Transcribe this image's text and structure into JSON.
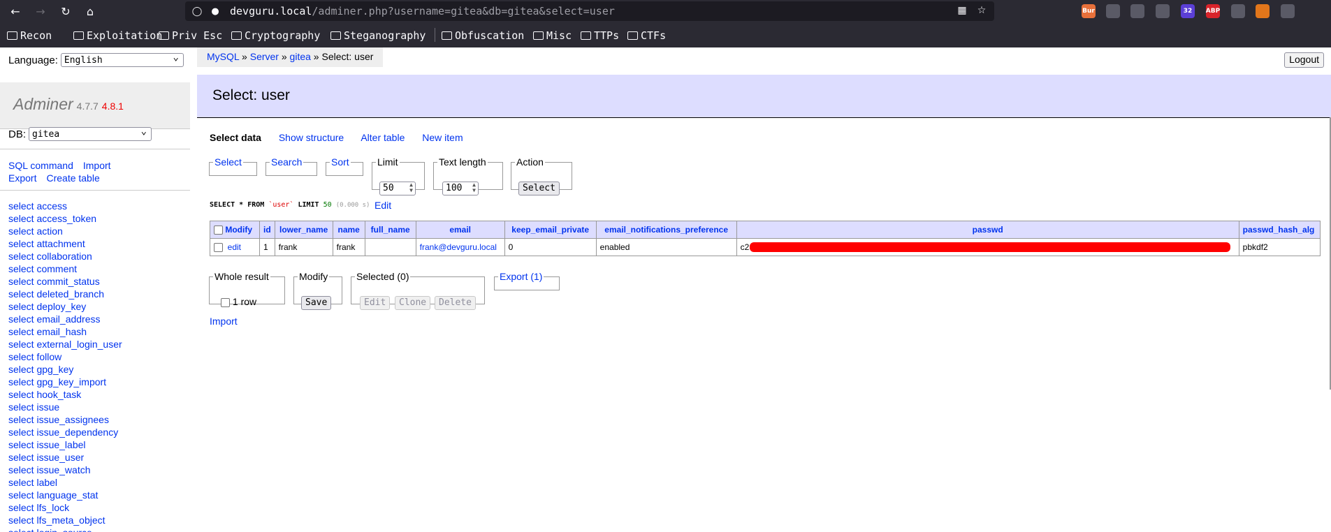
{
  "browser": {
    "url_host": "devguru.local",
    "url_path": "/adminer.php?username=gitea&db=gitea&select=user",
    "extensions": [
      {
        "name": "burp-extension",
        "label": "Bur",
        "color": "#e8703a"
      },
      {
        "name": "cookie-extension",
        "label": "",
        "color": "#5a5a66"
      },
      {
        "name": "wappalyzer-extension",
        "label": "",
        "color": "#5a5a66"
      },
      {
        "name": "foxyproxy-extension",
        "label": "",
        "color": "#5a5a66"
      },
      {
        "name": "vpn-extension",
        "label": "32",
        "color": "#5b3fd6"
      },
      {
        "name": "adblock-extension",
        "label": "ABP",
        "color": "#d8232a"
      },
      {
        "name": "extensions-menu",
        "label": "",
        "color": "#5a5a66"
      },
      {
        "name": "metamask-extension",
        "label": "",
        "color": "#e2761b"
      },
      {
        "name": "puzzle-extension",
        "label": "",
        "color": "#5a5a66"
      }
    ],
    "bookmarks": [
      "Recon",
      "Exploitation",
      "Priv Esc",
      "Cryptography",
      "Steganography",
      "Obfuscation",
      "Misc",
      "TTPs",
      "CTFs"
    ]
  },
  "sidebar": {
    "language_label": "Language:",
    "language_value": "English",
    "brand": "Adminer",
    "version": "4.7.7",
    "new_version": "4.8.1",
    "db_label": "DB:",
    "db_value": "gitea",
    "links": {
      "sql": "SQL command",
      "import": "Import",
      "export": "Export",
      "create": "Create table"
    },
    "tables": [
      "select access",
      "select access_token",
      "select action",
      "select attachment",
      "select collaboration",
      "select comment",
      "select commit_status",
      "select deleted_branch",
      "select deploy_key",
      "select email_address",
      "select email_hash",
      "select external_login_user",
      "select follow",
      "select gpg_key",
      "select gpg_key_import",
      "select hook_task",
      "select issue",
      "select issue_assignees",
      "select issue_dependency",
      "select issue_label",
      "select issue_user",
      "select issue_watch",
      "select label",
      "select language_stat",
      "select lfs_lock",
      "select lfs_meta_object",
      "select login_source"
    ]
  },
  "breadcrumb": {
    "mysql": "MySQL",
    "sep": "»",
    "server": "Server",
    "db": "gitea",
    "current": "Select: user"
  },
  "logout": "Logout",
  "page_title": "Select: user",
  "submenu": {
    "select_data": "Select data",
    "show_structure": "Show structure",
    "alter_table": "Alter table",
    "new_item": "New item"
  },
  "form": {
    "select": "Select",
    "search": "Search",
    "sort": "Sort",
    "limit_label": "Limit",
    "limit_value": "50",
    "text_length_label": "Text length",
    "text_length_value": "100",
    "action_label": "Action",
    "action_button": "Select"
  },
  "query": {
    "kw1": "SELECT",
    "rest1": "* FROM",
    "table": "`user`",
    "kw2": "LIMIT",
    "limit": "50",
    "time": "(0.000 s)",
    "edit": "Edit"
  },
  "grid": {
    "modify_header": "Modify",
    "columns": [
      "id",
      "lower_name",
      "name",
      "full_name",
      "email",
      "keep_email_private",
      "email_notifications_preference",
      "passwd",
      "passwd_hash_alg"
    ],
    "rows": [
      {
        "edit": "edit",
        "id": "1",
        "lower_name": "frank",
        "name": "frank",
        "full_name": "",
        "email": "frank@devguru.local",
        "keep_email_private": "0",
        "email_notifications_preference": "enabled",
        "passwd_prefix": "c2",
        "passwd_hash_alg": "pbkdf2"
      }
    ]
  },
  "bottom": {
    "whole_result": "Whole result",
    "rows_count": "1 row",
    "modify": "Modify",
    "save": "Save",
    "selected": "Selected (0)",
    "edit": "Edit",
    "clone": "Clone",
    "delete": "Delete",
    "export": "Export (1)",
    "import": "Import"
  }
}
